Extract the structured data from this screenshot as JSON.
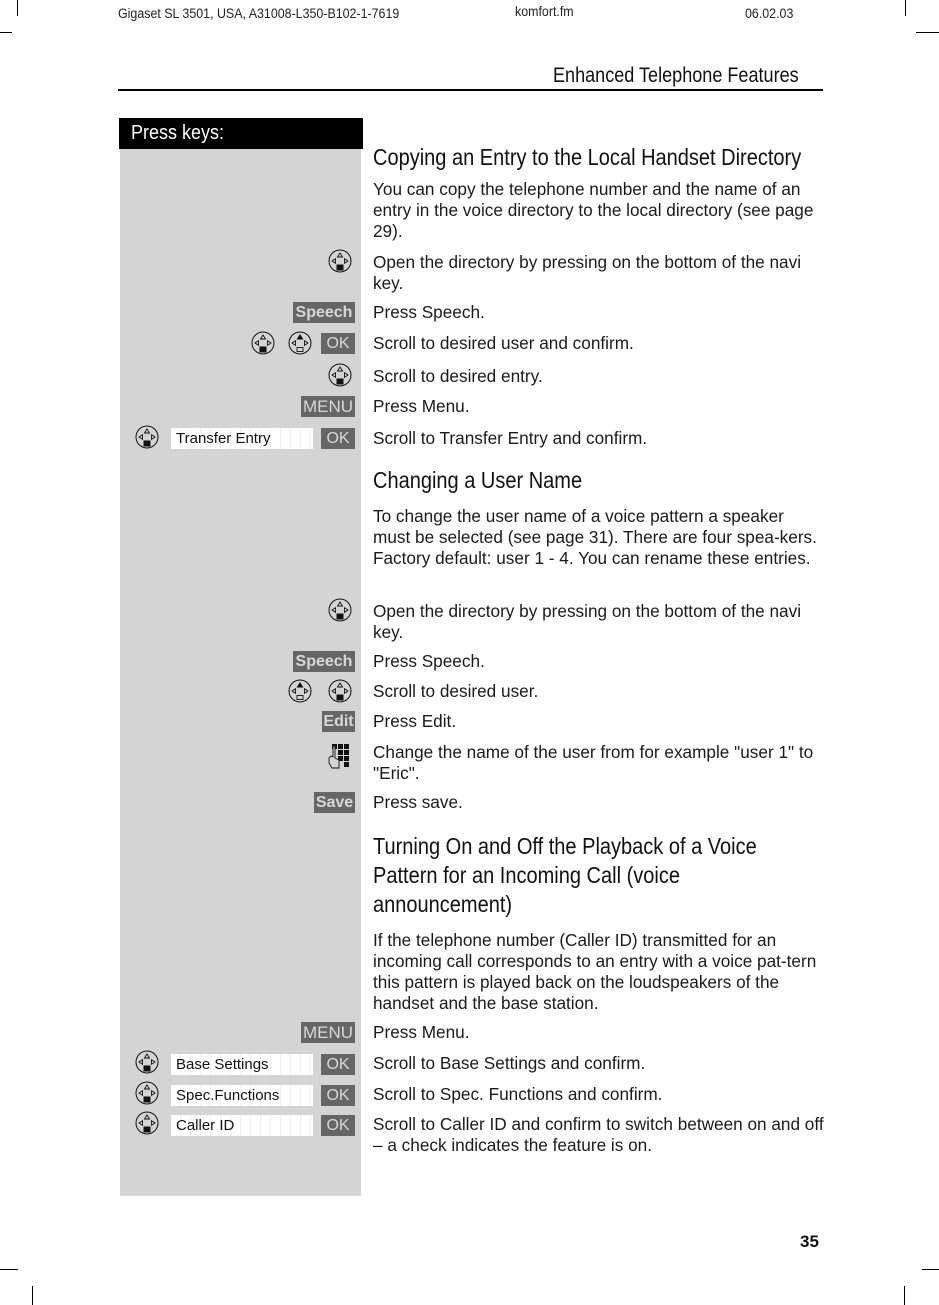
{
  "page_header": {
    "doc_id": "Gigaset SL 3501, USA, A31008-L350-B102-1-7619",
    "file": "komfort.fm",
    "date": "06.02.03",
    "chapter_title": "Enhanced Telephone Features"
  },
  "left_column": {
    "heading": "Press keys:"
  },
  "keys": {
    "speech": "Speech",
    "ok": "OK",
    "menu": "MENU",
    "edit": "Edit",
    "save": "Save"
  },
  "menu_fields": {
    "transfer_entry": "Transfer Entry",
    "base_settings": "Base Settings",
    "spec_functions": "Spec.Functions",
    "caller_id": "Caller ID"
  },
  "sections": [
    {
      "title": "Copying an Entry to the Local Handset Directory",
      "intro": "You can copy the telephone number and the name of an entry in the voice directory to the local directory (see page 29).",
      "steps": [
        "Open the directory by pressing on the bottom of the navi key.",
        "Press Speech.",
        "Scroll to desired user and confirm.",
        "Scroll to desired entry.",
        "Press Menu.",
        "Scroll to Transfer Entry and confirm."
      ]
    },
    {
      "title": "Changing a User Name",
      "intro": "To change the user name of a voice pattern a speaker must be selected (see page 31). There are four spea-kers. Factory default: user 1 - 4. You can rename these entries.",
      "steps": [
        "Open the directory by pressing on the bottom of the navi key.",
        "Press Speech.",
        "Scroll to desired user.",
        "Press Edit.",
        "Change the name of the user from for example \"user 1\" to \"Eric\".",
        "Press save."
      ]
    },
    {
      "title_lines": [
        "Turning On and Off the Playback of a Voice",
        "Pattern for an Incoming Call (voice",
        "announcement)"
      ],
      "intro": "If the telephone number (Caller ID) transmitted for an incoming call corresponds to an entry with a voice pat-tern this pattern is played back on the loudspeakers of the handset and the base station.",
      "steps": [
        "Press Menu.",
        "Scroll to Base Settings and confirm.",
        "Scroll to Spec. Functions and confirm.",
        "Scroll to Caller ID and confirm to switch between on and off – a check indicates the feature is on."
      ]
    }
  ],
  "page_number": "35",
  "colors": {
    "key_bg": "#666666",
    "key_text": "#d8d8d8",
    "column_bg": "#d4d4d4",
    "header_bar": "#000000"
  }
}
